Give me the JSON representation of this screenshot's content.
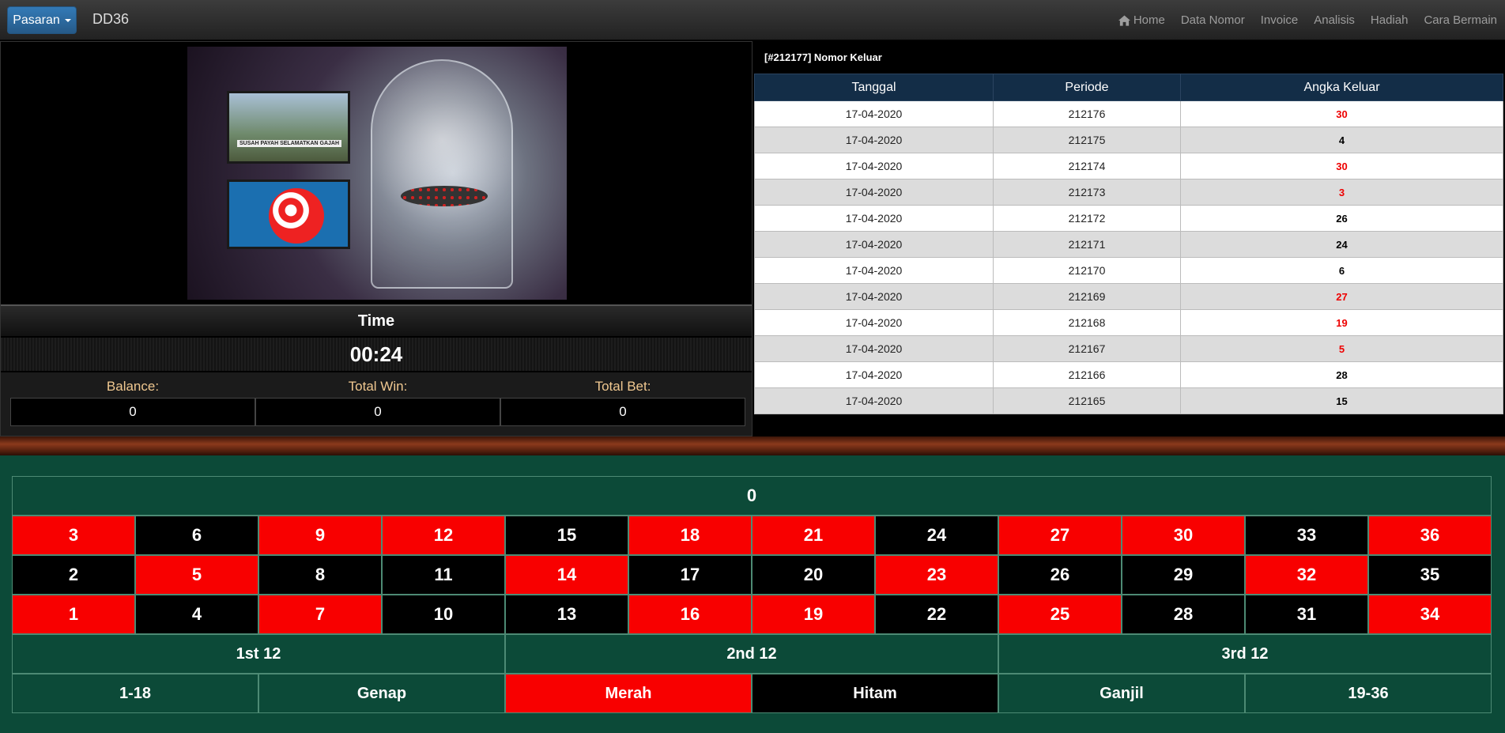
{
  "navbar": {
    "pasaran_label": "Pasaran",
    "brand": "DD36",
    "links": [
      "Home",
      "Data Nomor",
      "Invoice",
      "Analisis",
      "Hadiah",
      "Cara Bermain"
    ]
  },
  "video": {
    "caption": "SUSAH PAYAH SELAMATKAN GAJAH"
  },
  "timer": {
    "label": "Time",
    "value": "00:24"
  },
  "stats": {
    "balance_label": "Balance:",
    "balance": "0",
    "total_win_label": "Total Win:",
    "total_win": "0",
    "total_bet_label": "Total Bet:",
    "total_bet": "0"
  },
  "results": {
    "title": "[#212177] Nomor Keluar",
    "headers": [
      "Tanggal",
      "Periode",
      "Angka Keluar"
    ],
    "rows": [
      {
        "tanggal": "17-04-2020",
        "periode": "212176",
        "angka": "30",
        "color": "red"
      },
      {
        "tanggal": "17-04-2020",
        "periode": "212175",
        "angka": "4",
        "color": "black"
      },
      {
        "tanggal": "17-04-2020",
        "periode": "212174",
        "angka": "30",
        "color": "red"
      },
      {
        "tanggal": "17-04-2020",
        "periode": "212173",
        "angka": "3",
        "color": "red"
      },
      {
        "tanggal": "17-04-2020",
        "periode": "212172",
        "angka": "26",
        "color": "black"
      },
      {
        "tanggal": "17-04-2020",
        "periode": "212171",
        "angka": "24",
        "color": "black"
      },
      {
        "tanggal": "17-04-2020",
        "periode": "212170",
        "angka": "6",
        "color": "black"
      },
      {
        "tanggal": "17-04-2020",
        "periode": "212169",
        "angka": "27",
        "color": "red"
      },
      {
        "tanggal": "17-04-2020",
        "periode": "212168",
        "angka": "19",
        "color": "red"
      },
      {
        "tanggal": "17-04-2020",
        "periode": "212167",
        "angka": "5",
        "color": "red"
      },
      {
        "tanggal": "17-04-2020",
        "periode": "212166",
        "angka": "28",
        "color": "black"
      },
      {
        "tanggal": "17-04-2020",
        "periode": "212165",
        "angka": "15",
        "color": "black"
      }
    ]
  },
  "board": {
    "zero": "0",
    "rows": [
      [
        {
          "n": "3",
          "c": "red"
        },
        {
          "n": "6",
          "c": "black"
        },
        {
          "n": "9",
          "c": "red"
        },
        {
          "n": "12",
          "c": "red"
        },
        {
          "n": "15",
          "c": "black"
        },
        {
          "n": "18",
          "c": "red"
        },
        {
          "n": "21",
          "c": "red"
        },
        {
          "n": "24",
          "c": "black"
        },
        {
          "n": "27",
          "c": "red"
        },
        {
          "n": "30",
          "c": "red"
        },
        {
          "n": "33",
          "c": "black"
        },
        {
          "n": "36",
          "c": "red"
        }
      ],
      [
        {
          "n": "2",
          "c": "black"
        },
        {
          "n": "5",
          "c": "red"
        },
        {
          "n": "8",
          "c": "black"
        },
        {
          "n": "11",
          "c": "black"
        },
        {
          "n": "14",
          "c": "red"
        },
        {
          "n": "17",
          "c": "black"
        },
        {
          "n": "20",
          "c": "black"
        },
        {
          "n": "23",
          "c": "red"
        },
        {
          "n": "26",
          "c": "black"
        },
        {
          "n": "29",
          "c": "black"
        },
        {
          "n": "32",
          "c": "red"
        },
        {
          "n": "35",
          "c": "black"
        }
      ],
      [
        {
          "n": "1",
          "c": "red"
        },
        {
          "n": "4",
          "c": "black"
        },
        {
          "n": "7",
          "c": "red"
        },
        {
          "n": "10",
          "c": "black"
        },
        {
          "n": "13",
          "c": "black"
        },
        {
          "n": "16",
          "c": "red"
        },
        {
          "n": "19",
          "c": "red"
        },
        {
          "n": "22",
          "c": "black"
        },
        {
          "n": "25",
          "c": "red"
        },
        {
          "n": "28",
          "c": "black"
        },
        {
          "n": "31",
          "c": "black"
        },
        {
          "n": "34",
          "c": "red"
        }
      ]
    ],
    "dozens": [
      "1st 12",
      "2nd 12",
      "3rd 12"
    ],
    "outside": [
      {
        "label": "1-18",
        "c": "green"
      },
      {
        "label": "Genap",
        "c": "green"
      },
      {
        "label": "Merah",
        "c": "red"
      },
      {
        "label": "Hitam",
        "c": "black"
      },
      {
        "label": "Ganjil",
        "c": "green"
      },
      {
        "label": "19-36",
        "c": "green"
      }
    ]
  },
  "colors": {
    "red": "#f80000",
    "black": "#000000",
    "felt": "#0c4a38",
    "table_header": "#132d47"
  }
}
